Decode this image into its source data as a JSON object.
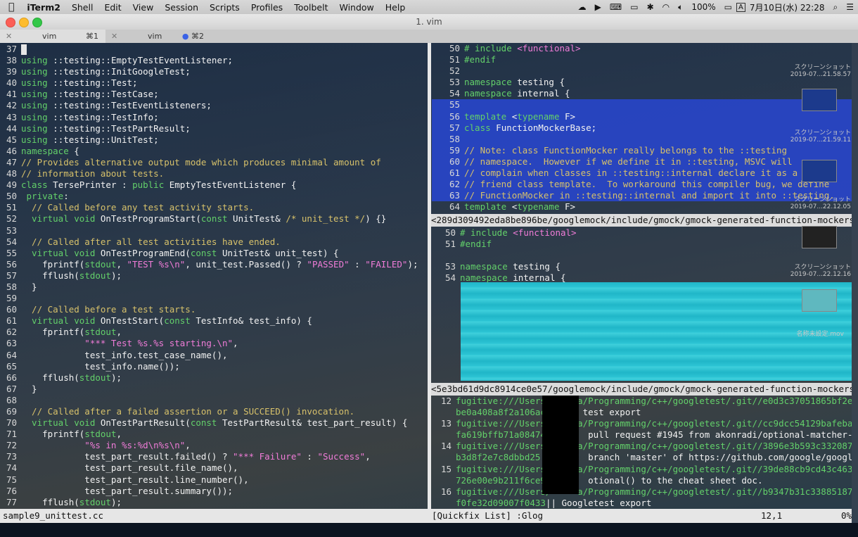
{
  "menubar": {
    "apple": "",
    "app": "iTerm2",
    "items": [
      "Shell",
      "Edit",
      "View",
      "Session",
      "Scripts",
      "Profiles",
      "Toolbelt",
      "Window",
      "Help"
    ],
    "battery": "100%",
    "input": "A",
    "datetime": "7月10日(水) 22:28"
  },
  "window": {
    "title": "1. vim"
  },
  "tabs": [
    {
      "name": "vim",
      "shortcut": "⌘1"
    },
    {
      "name": "vim",
      "shortcut": "⌘2"
    }
  ],
  "left_pane": {
    "lines": [
      {
        "n": "37",
        "parts": [
          [
            "c",
            ""
          ]
        ]
      },
      {
        "n": "38",
        "parts": [
          [
            "kw",
            "using"
          ],
          [
            "tx",
            " ::testing::EmptyTestEventListener;"
          ]
        ]
      },
      {
        "n": "39",
        "parts": [
          [
            "kw",
            "using"
          ],
          [
            "tx",
            " ::testing::InitGoogleTest;"
          ]
        ]
      },
      {
        "n": "40",
        "parts": [
          [
            "kw",
            "using"
          ],
          [
            "tx",
            " ::testing::Test;"
          ]
        ]
      },
      {
        "n": "41",
        "parts": [
          [
            "kw",
            "using"
          ],
          [
            "tx",
            " ::testing::TestCase;"
          ]
        ]
      },
      {
        "n": "42",
        "parts": [
          [
            "kw",
            "using"
          ],
          [
            "tx",
            " ::testing::TestEventListeners;"
          ]
        ]
      },
      {
        "n": "43",
        "parts": [
          [
            "kw",
            "using"
          ],
          [
            "tx",
            " ::testing::TestInfo;"
          ]
        ]
      },
      {
        "n": "44",
        "parts": [
          [
            "kw",
            "using"
          ],
          [
            "tx",
            " ::testing::TestPartResult;"
          ]
        ]
      },
      {
        "n": "45",
        "parts": [
          [
            "kw",
            "using"
          ],
          [
            "tx",
            " ::testing::UnitTest;"
          ]
        ]
      },
      {
        "n": "46",
        "parts": [
          [
            "kw",
            "namespace"
          ],
          [
            "tx",
            " {"
          ]
        ]
      },
      {
        "n": "47",
        "parts": [
          [
            "cm",
            "// Provides alternative output mode which produces minimal amount of"
          ]
        ]
      },
      {
        "n": "48",
        "parts": [
          [
            "cm",
            "// information about tests."
          ]
        ]
      },
      {
        "n": "49",
        "parts": [
          [
            "kw",
            "class"
          ],
          [
            "tx",
            " TersePrinter : "
          ],
          [
            "kw",
            "public"
          ],
          [
            "tx",
            " EmptyTestEventListener {"
          ]
        ]
      },
      {
        "n": "50",
        "parts": [
          [
            "kw",
            " private"
          ],
          [
            "tx",
            ":"
          ]
        ]
      },
      {
        "n": "51",
        "parts": [
          [
            "cm",
            "  // Called before any test activity starts."
          ]
        ]
      },
      {
        "n": "52",
        "parts": [
          [
            "kw",
            "  virtual void"
          ],
          [
            "tx",
            " OnTestProgramStart("
          ],
          [
            "kw",
            "const"
          ],
          [
            "tx",
            " UnitTest& "
          ],
          [
            "cm",
            "/* unit_test */"
          ],
          [
            "tx",
            ") {}"
          ]
        ]
      },
      {
        "n": "53",
        "parts": [
          [
            "tx",
            ""
          ]
        ]
      },
      {
        "n": "54",
        "parts": [
          [
            "cm",
            "  // Called after all test activities have ended."
          ]
        ]
      },
      {
        "n": "55",
        "parts": [
          [
            "kw",
            "  virtual void"
          ],
          [
            "tx",
            " OnTestProgramEnd("
          ],
          [
            "kw",
            "const"
          ],
          [
            "tx",
            " UnitTest& unit_test) {"
          ]
        ]
      },
      {
        "n": "56",
        "parts": [
          [
            "tx",
            "    fprintf("
          ],
          [
            "kw",
            "stdout"
          ],
          [
            "tx",
            ", "
          ],
          [
            "st",
            "\"TEST %s\\n\""
          ],
          [
            "tx",
            ", unit_test.Passed() ? "
          ],
          [
            "st",
            "\"PASSED\""
          ],
          [
            "tx",
            " : "
          ],
          [
            "st",
            "\"FAILED\""
          ],
          [
            "tx",
            ");"
          ]
        ]
      },
      {
        "n": "57",
        "parts": [
          [
            "tx",
            "    fflush("
          ],
          [
            "kw",
            "stdout"
          ],
          [
            "tx",
            ");"
          ]
        ]
      },
      {
        "n": "58",
        "parts": [
          [
            "tx",
            "  }"
          ]
        ]
      },
      {
        "n": "59",
        "parts": [
          [
            "tx",
            ""
          ]
        ]
      },
      {
        "n": "60",
        "parts": [
          [
            "cm",
            "  // Called before a test starts."
          ]
        ]
      },
      {
        "n": "61",
        "parts": [
          [
            "kw",
            "  virtual void"
          ],
          [
            "tx",
            " OnTestStart("
          ],
          [
            "kw",
            "const"
          ],
          [
            "tx",
            " TestInfo& test_info) {"
          ]
        ]
      },
      {
        "n": "62",
        "parts": [
          [
            "tx",
            "    fprintf("
          ],
          [
            "kw",
            "stdout"
          ],
          [
            "tx",
            ","
          ]
        ]
      },
      {
        "n": "63",
        "parts": [
          [
            "st",
            "            \"*** Test %s.%s starting.\\n\""
          ],
          [
            "tx",
            ","
          ]
        ]
      },
      {
        "n": "64",
        "parts": [
          [
            "tx",
            "            test_info.test_case_name(),"
          ]
        ]
      },
      {
        "n": "65",
        "parts": [
          [
            "tx",
            "            test_info.name());"
          ]
        ]
      },
      {
        "n": "66",
        "parts": [
          [
            "tx",
            "    fflush("
          ],
          [
            "kw",
            "stdout"
          ],
          [
            "tx",
            ");"
          ]
        ]
      },
      {
        "n": "67",
        "parts": [
          [
            "tx",
            "  }"
          ]
        ]
      },
      {
        "n": "68",
        "parts": [
          [
            "tx",
            ""
          ]
        ]
      },
      {
        "n": "69",
        "parts": [
          [
            "cm",
            "  // Called after a failed assertion or a SUCCEED() invocation."
          ]
        ]
      },
      {
        "n": "70",
        "parts": [
          [
            "kw",
            "  virtual void"
          ],
          [
            "tx",
            " OnTestPartResult("
          ],
          [
            "kw",
            "const"
          ],
          [
            "tx",
            " TestPartResult& test_part_result) {"
          ]
        ]
      },
      {
        "n": "71",
        "parts": [
          [
            "tx",
            "    fprintf("
          ],
          [
            "kw",
            "stdout"
          ],
          [
            "tx",
            ","
          ]
        ]
      },
      {
        "n": "72",
        "parts": [
          [
            "st",
            "            \"%s in %s:%d\\n%s\\n\""
          ],
          [
            "tx",
            ","
          ]
        ]
      },
      {
        "n": "73",
        "parts": [
          [
            "tx",
            "            test_part_result.failed() ? "
          ],
          [
            "st",
            "\"*** Failure\""
          ],
          [
            "tx",
            " : "
          ],
          [
            "st",
            "\"Success\""
          ],
          [
            "tx",
            ","
          ]
        ]
      },
      {
        "n": "74",
        "parts": [
          [
            "tx",
            "            test_part_result.file_name(),"
          ]
        ]
      },
      {
        "n": "75",
        "parts": [
          [
            "tx",
            "            test_part_result.line_number(),"
          ]
        ]
      },
      {
        "n": "76",
        "parts": [
          [
            "tx",
            "            test_part_result.summary());"
          ]
        ]
      },
      {
        "n": "77",
        "parts": [
          [
            "tx",
            "    fflush("
          ],
          [
            "kw",
            "stdout"
          ],
          [
            "tx",
            ");"
          ]
        ]
      }
    ]
  },
  "right_top": {
    "lines": [
      {
        "n": "50",
        "parts": [
          [
            "kw",
            "# include"
          ],
          [
            "tx",
            " "
          ],
          [
            "st",
            "<functional>"
          ]
        ]
      },
      {
        "n": "51",
        "parts": [
          [
            "kw",
            "#endif"
          ]
        ]
      },
      {
        "n": "52",
        "parts": [
          [
            "tx",
            ""
          ]
        ]
      },
      {
        "n": "53",
        "parts": [
          [
            "kw",
            "namespace"
          ],
          [
            "tx",
            " testing {"
          ]
        ]
      },
      {
        "n": "54",
        "parts": [
          [
            "kw",
            "namespace"
          ],
          [
            "tx",
            " internal {"
          ]
        ]
      },
      {
        "n": "55",
        "parts": [
          [
            "tx",
            ""
          ]
        ]
      },
      {
        "n": "56",
        "parts": [
          [
            "kw",
            "template"
          ],
          [
            "tx",
            " <"
          ],
          [
            "kw",
            "typename"
          ],
          [
            "tx",
            " F>"
          ]
        ]
      },
      {
        "n": "57",
        "parts": [
          [
            "kw",
            "class"
          ],
          [
            "tx",
            " FunctionMockerBase;"
          ]
        ]
      },
      {
        "n": "58",
        "parts": [
          [
            "tx",
            ""
          ]
        ]
      },
      {
        "n": "59",
        "parts": [
          [
            "cm",
            "// Note: class FunctionMocker really belongs to the ::testing"
          ]
        ]
      },
      {
        "n": "60",
        "parts": [
          [
            "cm",
            "// namespace.  However if we define it in ::testing, MSVC will"
          ]
        ]
      },
      {
        "n": "61",
        "parts": [
          [
            "cm",
            "// complain when classes in ::testing::internal declare it as a"
          ]
        ]
      },
      {
        "n": "62",
        "parts": [
          [
            "cm",
            "// friend class template.  To workaround this compiler bug, we define"
          ]
        ]
      },
      {
        "n": "63",
        "parts": [
          [
            "cm",
            "// FunctionMocker in ::testing::internal and import it into ::testing."
          ]
        ]
      },
      {
        "n": "64",
        "parts": [
          [
            "kw",
            "template"
          ],
          [
            "tx",
            " <"
          ],
          [
            "kw",
            "typename"
          ],
          [
            "tx",
            " F>"
          ]
        ]
      }
    ],
    "status": "<289d309492eda8be896be/googlemock/include/gmock/gmock-generated-function-mockers.h [RO]"
  },
  "right_mid": {
    "lines": [
      {
        "n": "50",
        "parts": [
          [
            "kw",
            "# include"
          ],
          [
            "tx",
            " "
          ],
          [
            "st",
            "<functional>"
          ]
        ]
      },
      {
        "n": "51",
        "parts": [
          [
            "kw",
            "#endif"
          ]
        ]
      },
      {
        "n": "",
        "parts": [
          [
            "tx",
            ""
          ]
        ]
      },
      {
        "n": "53",
        "parts": [
          [
            "kw",
            "namespace"
          ],
          [
            "tx",
            " testing {"
          ]
        ]
      },
      {
        "n": "54",
        "parts": [
          [
            "kw",
            "namespace"
          ],
          [
            "tx",
            " internal {"
          ]
        ]
      }
    ],
    "status": "<5e3bd61d9dc8914ce0e57/googlemock/include/gmock/gmock-generated-function-mockers.h [RO]"
  },
  "quickfix": {
    "lines": [
      {
        "n": "12",
        "parts": [
          [
            "kw",
            "fugitive:///Users/"
          ],
          [
            "tx",
            "     "
          ],
          [
            "kw",
            "a/Programming/c++/googletest/.git//e0d3c37051865bf2ec32de3"
          ]
        ]
      },
      {
        "n": "",
        "parts": [
          [
            "kw",
            "be0a408a8f2a106ac"
          ],
          [
            "tx",
            "       test export"
          ]
        ]
      },
      {
        "n": "13",
        "parts": [
          [
            "kw",
            "fugitive:///Users/"
          ],
          [
            "tx",
            "     "
          ],
          [
            "kw",
            "a/Programming/c++/googletest/.git//cc9dcc54129bafebaeb8e9f"
          ]
        ]
      },
      {
        "n": "",
        "parts": [
          [
            "kw",
            "fa619bffb71a08474"
          ],
          [
            "tx",
            "        pull request #1945 from akonradi/optional-matcher-doc"
          ]
        ]
      },
      {
        "n": "14",
        "parts": [
          [
            "kw",
            "fugitive:///Users/"
          ],
          [
            "tx",
            "     "
          ],
          [
            "kw",
            "a/Programming/c++/googletest/.git//3896e3b593c332087564a76"
          ]
        ]
      },
      {
        "n": "",
        "parts": [
          [
            "kw",
            "b3d8f2e7c8dbbd25"
          ],
          [
            "tx",
            "         branch 'master' of https://github.com/google/googletest"
          ]
        ]
      },
      {
        "n": "15",
        "parts": [
          [
            "kw",
            "fugitive:///Users/"
          ],
          [
            "tx",
            "     "
          ],
          [
            "kw",
            "a/Programming/c++/googletest/.git//39de88cb9cd43c46330bf20"
          ]
        ]
      },
      {
        "n": "",
        "parts": [
          [
            "kw",
            "726e00e9b211f6ce9"
          ],
          [
            "tx",
            "        otional() to the cheat sheet doc."
          ]
        ]
      },
      {
        "n": "16",
        "parts": [
          [
            "kw",
            "fugitive:///Users/"
          ],
          [
            "tx",
            "     "
          ],
          [
            "kw",
            "a/Programming/c++/googletest/.git//b9347b31c338851879d0105"
          ]
        ]
      },
      {
        "n": "",
        "parts": [
          [
            "kw",
            "f0fe32d09007f0433"
          ],
          [
            "tx",
            "|| Googletest export"
          ]
        ]
      }
    ]
  },
  "bottombar": {
    "left": "sample9_unittest.cc",
    "quickfix_label": "[Quickfix List] :Glog",
    "position": "12,1",
    "percent": "0%"
  },
  "desktop": [
    {
      "label": "スクリーンショット",
      "date": "2019-07...21.58.57"
    },
    {
      "label": "スクリーンショット",
      "date": "2019-07...21.59.11"
    },
    {
      "label": "スクリーンショット",
      "date": "2019-07...22.12.05"
    },
    {
      "label": "スクリーンショット",
      "date": "2019-07...22.12.16"
    },
    {
      "label": "名称未設定.mov",
      "date": ""
    }
  ]
}
